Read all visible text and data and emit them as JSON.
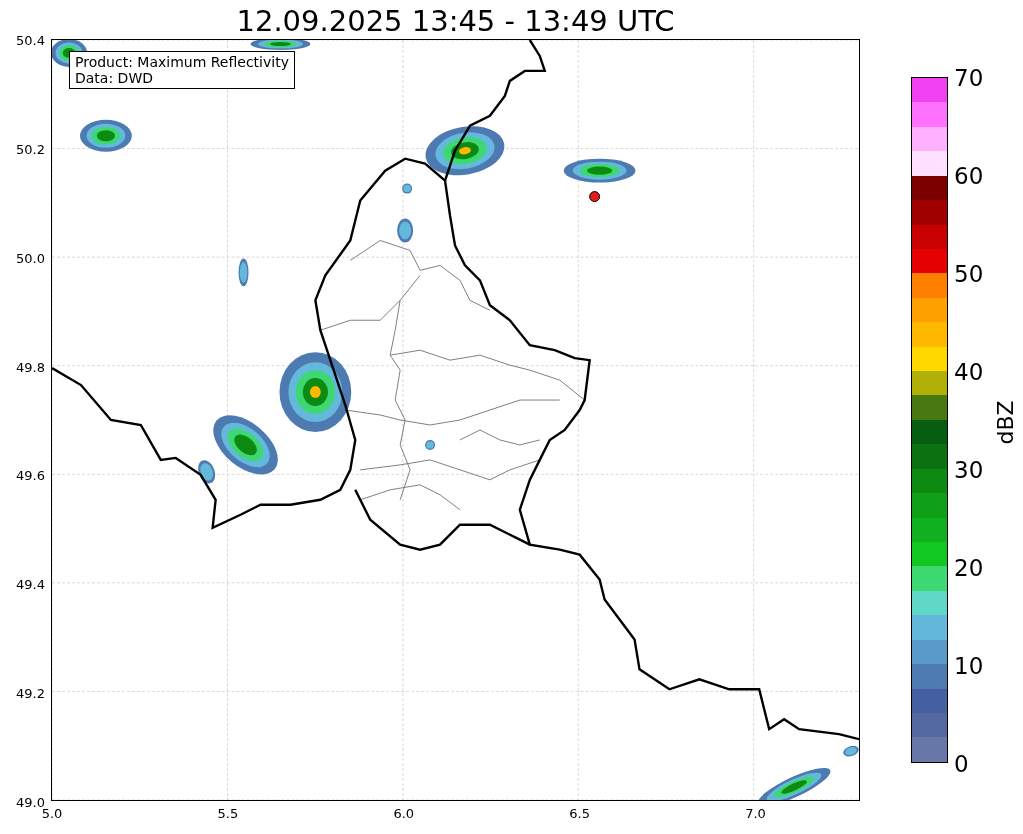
{
  "title": "12.09.2025 13:45 - 13:49 UTC",
  "annotation": [
    "Product: Maximum Reflectivity",
    "Data: DWD"
  ],
  "map": {
    "x_ticks": [
      "5.0",
      "5.5",
      "6.0",
      "6.5",
      "7.0"
    ],
    "y_ticks": [
      "50.4",
      "50.2",
      "50.0",
      "49.8",
      "49.6",
      "49.4",
      "49.2",
      "49.0"
    ],
    "marker": {
      "color": "#e41a1c"
    }
  },
  "colorbar": {
    "label": "dBZ",
    "ticks": [
      "70",
      "60",
      "50",
      "40",
      "30",
      "20",
      "10",
      "0"
    ],
    "segments": [
      {
        "color": "#6677a8"
      },
      {
        "color": "#5468a0"
      },
      {
        "color": "#4460a0"
      },
      {
        "color": "#4d7ab0"
      },
      {
        "color": "#5a9ac8"
      },
      {
        "color": "#64b8dc"
      },
      {
        "color": "#60d8c8"
      },
      {
        "color": "#3ed872"
      },
      {
        "color": "#10c820"
      },
      {
        "color": "#10b020"
      },
      {
        "color": "#10a018"
      },
      {
        "color": "#0c8a12"
      },
      {
        "color": "#0a7210"
      },
      {
        "color": "#085e10"
      },
      {
        "color": "#4a7810"
      },
      {
        "color": "#b0b008"
      },
      {
        "color": "#ffd800"
      },
      {
        "color": "#ffb800"
      },
      {
        "color": "#ffa000"
      },
      {
        "color": "#ff8000"
      },
      {
        "color": "#e40000"
      },
      {
        "color": "#c80000"
      },
      {
        "color": "#a00000"
      },
      {
        "color": "#7c0000"
      },
      {
        "color": "#ffe0ff"
      },
      {
        "color": "#ffb0ff"
      },
      {
        "color": "#ff70ff"
      },
      {
        "color": "#f040f0"
      }
    ]
  }
}
